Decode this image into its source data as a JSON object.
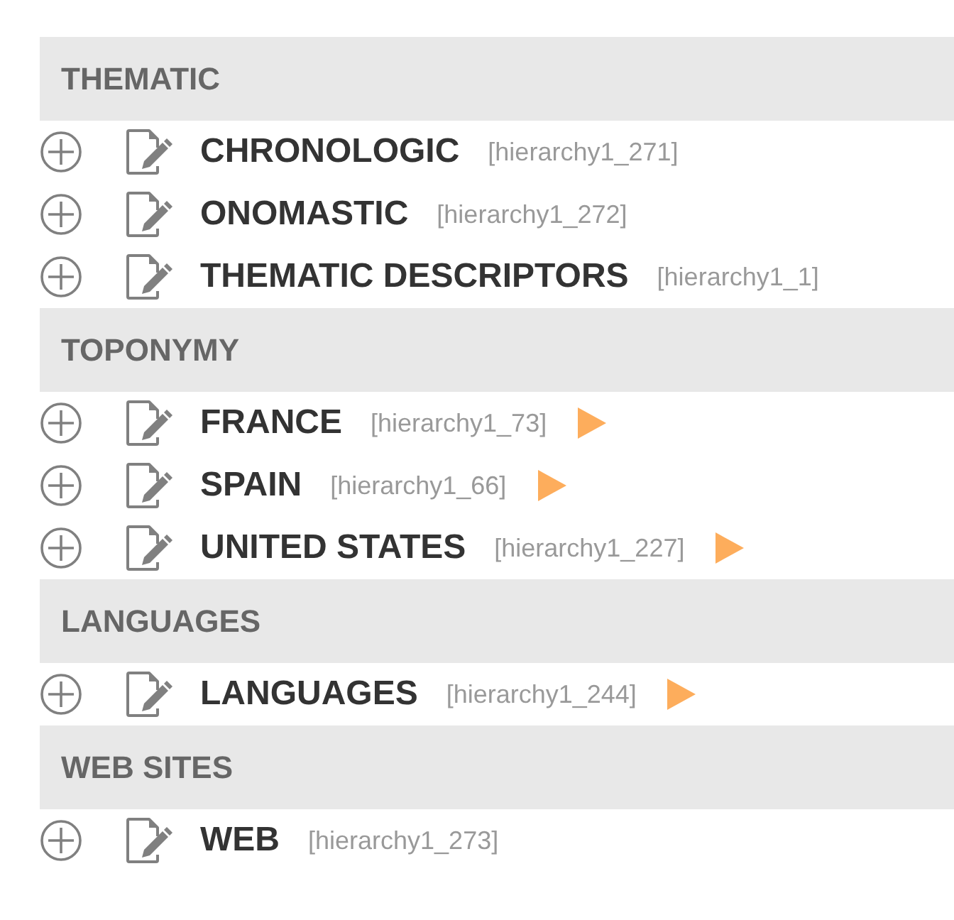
{
  "sections": [
    {
      "title": "THEMATIC",
      "items": [
        {
          "label": "CHRONOLOGIC",
          "code": "[hierarchy1_271]",
          "expandable": false
        },
        {
          "label": "ONOMASTIC",
          "code": "[hierarchy1_272]",
          "expandable": false
        },
        {
          "label": "THEMATIC DESCRIPTORS",
          "code": "[hierarchy1_1]",
          "expandable": false
        }
      ]
    },
    {
      "title": "TOPONYMY",
      "items": [
        {
          "label": "FRANCE",
          "code": "[hierarchy1_73]",
          "expandable": true
        },
        {
          "label": "SPAIN",
          "code": "[hierarchy1_66]",
          "expandable": true
        },
        {
          "label": "UNITED STATES",
          "code": "[hierarchy1_227]",
          "expandable": true
        }
      ]
    },
    {
      "title": "LANGUAGES",
      "items": [
        {
          "label": "LANGUAGES",
          "code": "[hierarchy1_244]",
          "expandable": true
        }
      ]
    },
    {
      "title": "WEB SITES",
      "items": [
        {
          "label": "WEB",
          "code": "[hierarchy1_273]",
          "expandable": false
        }
      ]
    }
  ]
}
